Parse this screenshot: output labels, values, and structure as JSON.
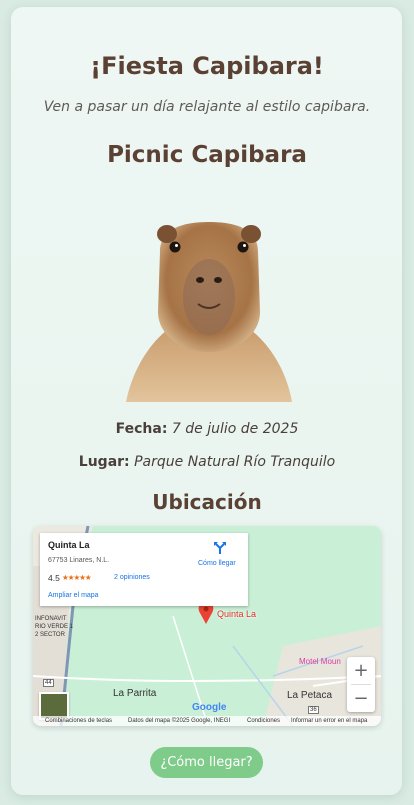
{
  "header": {
    "title": "¡Fiesta Capibara!",
    "subtitle": "Ven a pasar un día relajante al estilo capibara."
  },
  "event": {
    "title": "Picnic Capibara",
    "date_label": "Fecha:",
    "date_value": "7 de julio de 2025",
    "place_label": "Lugar:",
    "place_value": "Parque Natural Río Tranquilo"
  },
  "location": {
    "title": "Ubicación",
    "map": {
      "place_name": "Quinta La",
      "address": "67753 Linares, N.L.",
      "rating": "4.5",
      "stars": "★★★★★",
      "reviews": "2 opiniones",
      "enlarge_link": "Ampliar el mapa",
      "directions_label": "Cómo llegar",
      "pin_label": "Quinta La",
      "labels": {
        "la_parrita": "La Parrita",
        "la_petaca": "La Petaca",
        "motel": "Motel Moun",
        "infonavit": "INFONAVIT",
        "rio_verde": "RIO VERDE 1",
        "sector": "2 SECTOR",
        "road_44": "44",
        "road_36": "36"
      },
      "google_logo": "Google",
      "footer": {
        "shortcuts": "Combinaciones de teclas",
        "map_data": "Datos del mapa ©2025 Google, INEGI",
        "terms": "Condiciones",
        "report": "Informar un error en el mapa"
      }
    }
  },
  "cta": {
    "label": "¿Cómo llegar?"
  },
  "colors": {
    "heading": "#5b4034",
    "accent": "#7fcb8a",
    "map_green": "#c9f0d6",
    "link": "#1a73e8"
  }
}
